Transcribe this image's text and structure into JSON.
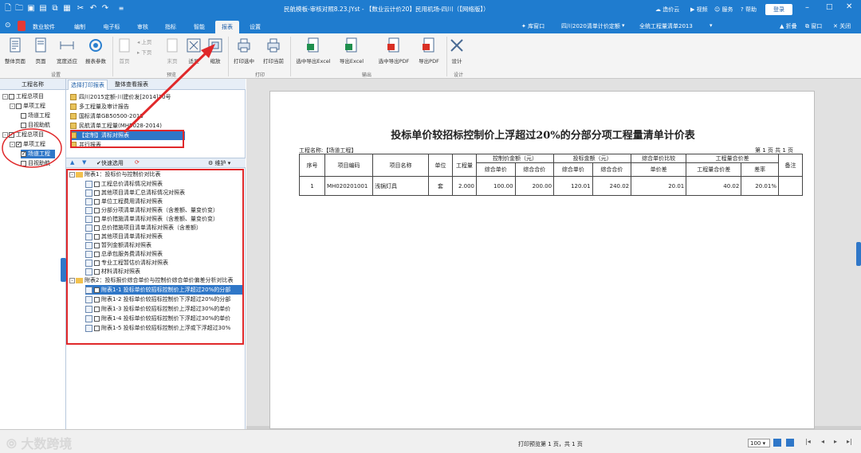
{
  "title_bar": {
    "text": "民航模板-审核对照8.23.JYst - 【数业云计价20】民用机场-四川（【网络版】）",
    "cloud": "造价云",
    "video": "视频",
    "service": "服务",
    "help": "帮助",
    "login": "登录"
  },
  "tabs": [
    "数业软件",
    "编制",
    "电子标",
    "审核",
    "指标",
    "智能",
    "报表",
    "设置"
  ],
  "tab_right": {
    "library": "库窗口",
    "quota": "四川2020清单计价定额",
    "scope": "全统工程量清单2013",
    "fold": "折叠",
    "window": "窗口",
    "close": "关闭"
  },
  "ribbon": {
    "buttons": [
      "整体页面",
      "页面",
      "宽度适应",
      "报表参数",
      "首页",
      "上页",
      "下页",
      "末页",
      "适显",
      "缩放",
      "打印选中",
      "打印当前",
      "选中导出Excel",
      "导出Excel",
      "选中导出PDF",
      "导出PDF",
      "设计"
    ],
    "groups": [
      "设置",
      "预览",
      "打印",
      "输出",
      "设计"
    ]
  },
  "left_pane": {
    "header": "工程名称",
    "items": [
      "工程总项目",
      "单项工程",
      "场道工程",
      "目视助航",
      "工程总项目",
      "单项工程",
      "场道工程",
      "目视助航"
    ]
  },
  "mid_pane": {
    "tabs": [
      "选择打印报表",
      "整体查看报表"
    ],
    "reports": [
      "四川2015定额-川建价发[2014]30号",
      "多工程量及审计报告",
      "国标清单GB50500-2013",
      "民航清单工程量(MH5028-2014)",
      "【定制】清标对照表",
      "并行报表"
    ],
    "toolbar": {
      "quick": "快速选用",
      "maintain": "维护"
    },
    "tree": {
      "group1": "附表1：投标价与控制价对比表",
      "items1": [
        "工程总价清标情况对照表",
        "其他项目清单汇总清标情况对照表",
        "单位工程费用清标对照表",
        "分部分项清单清标对照表（含差额、量变价变）",
        "单价措施清单清标对照表（含差额、量变价变）",
        "总价措施项目清单清标对照表（含差额）",
        "其他项目清单清标对照表",
        "暂列金额清标对照表",
        "总承包服务费清标对照表",
        "专业工程暂估价清标对照表",
        "材料清标对照表"
      ],
      "group2": "附表2：投标报价综合单价与控制价综合单价偏差分析对比表",
      "items2": [
        "附表1-1 投标单价较招标控制价上浮超过20%的分部",
        "附表1-2 投标单价较招标控制价下浮超过20%的分部",
        "附表1-3 投标单价较招标控制价上浮超过30%的单价",
        "附表1-4 投标单价较招标控制价下浮超过30%的单价",
        "附表1-5 投标单价较招标控制价上浮或下浮超过30%"
      ]
    }
  },
  "report": {
    "title": "投标单价较招标控制价上浮超过20%的分部分项工程量清单计价表",
    "project_label": "工程名称:【场道工程】",
    "page_info": "第 1 页 共 1 页",
    "head": {
      "seq": "序号",
      "code": "项目编码",
      "name": "项目名称",
      "unit": "单位",
      "qty": "工程量",
      "ctrl": "控制价金额（元）",
      "bid": "投标金额（元）",
      "cmp": "综合单价比较",
      "qtysum": "工程量合价差",
      "note": "备注",
      "ctrl_unit": "综合单价",
      "ctrl_total": "综合合价",
      "bid_unit": "综合单价",
      "bid_total": "综合合价",
      "diff": "单价差",
      "qdiff": "工程量合价差",
      "rate": "差率"
    },
    "rows": [
      {
        "seq": "1",
        "code": "MH020201001",
        "name": "浅锅灯具",
        "unit": "套",
        "qty": "2.000",
        "cu": "100.00",
        "ct": "200.00",
        "bu": "120.01",
        "bt": "240.02",
        "diff": "20.01",
        "qd": "40.02",
        "rate": "20.01%",
        "note": ""
      }
    ]
  },
  "status": {
    "text": "打印预览第 1 页，共 1 页",
    "zoom": "100"
  },
  "watermark": "大数跨境"
}
